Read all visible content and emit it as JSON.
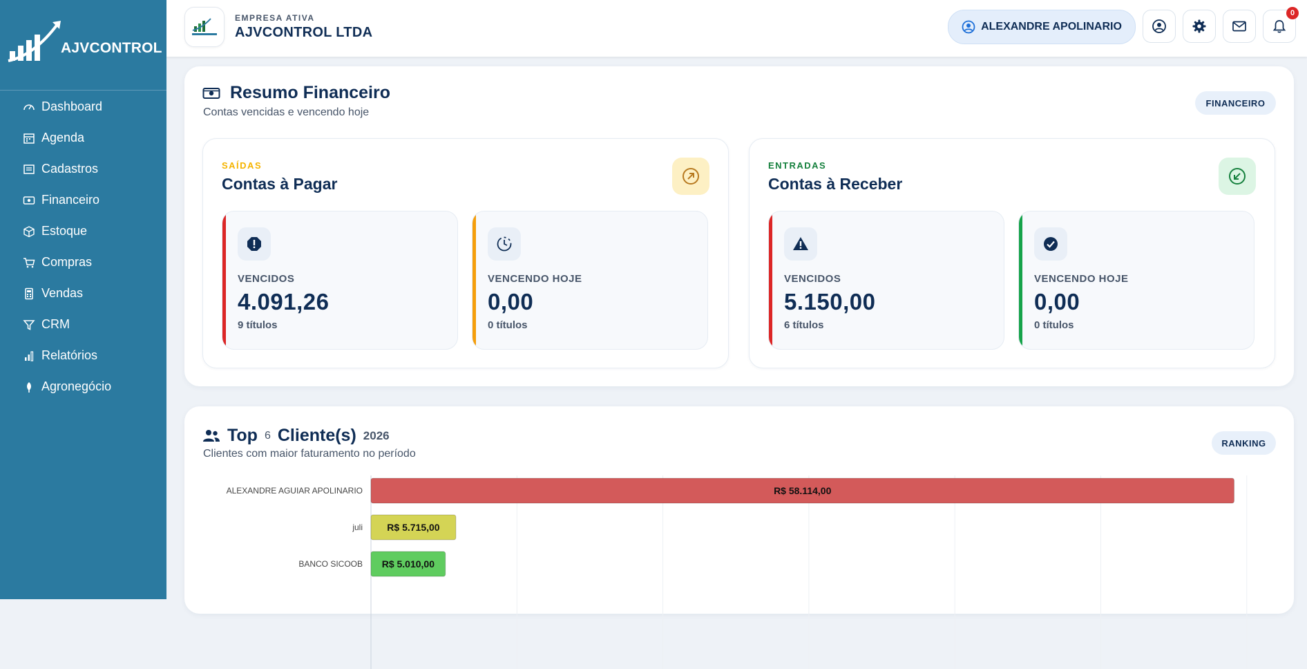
{
  "sidebar": {
    "brand": "AJVCONTROL",
    "items": [
      {
        "label": "Dashboard",
        "icon": "gauge-icon"
      },
      {
        "label": "Agenda",
        "icon": "calendar-icon"
      },
      {
        "label": "Cadastros",
        "icon": "list-icon"
      },
      {
        "label": "Financeiro",
        "icon": "money-icon"
      },
      {
        "label": "Estoque",
        "icon": "box-icon"
      },
      {
        "label": "Compras",
        "icon": "cart-icon"
      },
      {
        "label": "Vendas",
        "icon": "calculator-icon"
      },
      {
        "label": "CRM",
        "icon": "filter-icon"
      },
      {
        "label": "Relatórios",
        "icon": "bar-chart-icon"
      },
      {
        "label": "Agronegócio",
        "icon": "plant-icon"
      }
    ]
  },
  "topbar": {
    "company_label": "EMPRESA ATIVA",
    "company_name": "AJVCONTROL LTDA",
    "user_name": "ALEXANDRE APOLINARIO",
    "notification_count": "0"
  },
  "financial": {
    "title": "Resumo Financeiro",
    "subtitle": "Contas vencidas e vencendo hoje",
    "tag": "FINANCEIRO",
    "payables": {
      "kicker": "SAÍDAS",
      "title": "Contas à Pagar",
      "overdue": {
        "label": "VENCIDOS",
        "value": "4.091,26",
        "count": "9 títulos"
      },
      "due_today": {
        "label": "VENCENDO HOJE",
        "value": "0,00",
        "count": "0 títulos"
      }
    },
    "receivables": {
      "kicker": "ENTRADAS",
      "title": "Contas à Receber",
      "overdue": {
        "label": "VENCIDOS",
        "value": "5.150,00",
        "count": "6 títulos"
      },
      "due_today": {
        "label": "VENCENDO HOJE",
        "value": "0,00",
        "count": "0 títulos"
      }
    }
  },
  "ranking": {
    "title_prefix": "Top",
    "count": "6",
    "title_suffix": "Cliente(s)",
    "year": "2026",
    "subtitle": "Clientes com maior faturamento no período",
    "tag": "RANKING"
  },
  "colors": {
    "sidebar": "#2b7aa0",
    "danger": "#dc2626",
    "warning": "#f59e0b",
    "success": "#16a34a"
  },
  "chart_data": {
    "type": "bar",
    "orientation": "horizontal",
    "categories": [
      "ALEXANDRE AGUIAR APOLINARIO",
      "juli",
      "BANCO SICOOB"
    ],
    "values": [
      58114,
      5715,
      5010
    ],
    "value_labels": [
      "R$ 58.114,00",
      "R$ 5.715,00",
      "R$ 5.010,00"
    ],
    "bar_colors": [
      "#d35a5a",
      "#d4d455",
      "#5fcc5f"
    ],
    "xlim": [
      0,
      60000
    ],
    "grid": true
  }
}
